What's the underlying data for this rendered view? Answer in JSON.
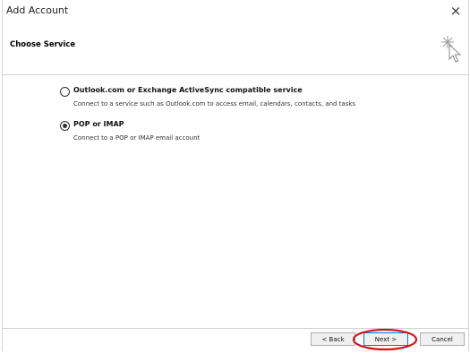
{
  "window": {
    "title": "Add Account",
    "close_symbol": "×"
  },
  "header": {
    "title": "Choose Service",
    "icon": "wizard-sparkle-cursor-icon"
  },
  "options": [
    {
      "label": "Outlook.com or Exchange ActiveSync compatible service",
      "description": "Connect to a service such as Outlook.com to access email, calendars, contacts, and tasks",
      "selected": false
    },
    {
      "label": "POP or IMAP",
      "description": "Connect to a POP or IMAP email account",
      "selected": true
    }
  ],
  "footer": {
    "back_label": "< Back",
    "next_label": "Next >",
    "cancel_label": "Cancel"
  },
  "colors": {
    "highlight": "#d2151c",
    "accent": "#0078d7"
  }
}
